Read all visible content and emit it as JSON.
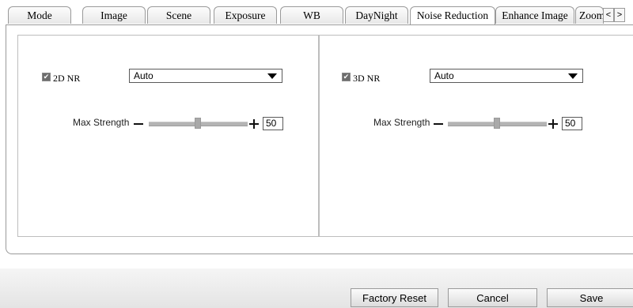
{
  "tabs": [
    {
      "label": "Mode",
      "active": false
    },
    {
      "label": "Image",
      "active": false
    },
    {
      "label": "Scene",
      "active": false
    },
    {
      "label": "Exposure",
      "active": false
    },
    {
      "label": "WB",
      "active": false
    },
    {
      "label": "DayNight",
      "active": false
    },
    {
      "label": "Noise Reduction",
      "active": true
    },
    {
      "label": "Enhance Image",
      "active": false
    },
    {
      "label": "Zoom",
      "active": false
    }
  ],
  "tab_nav": {
    "prev": "<",
    "next": ">"
  },
  "nr2d": {
    "checkbox_label": "2D NR",
    "checked": true,
    "mode": "Auto",
    "max_strength_label": "Max Strength",
    "max_strength_value": "50"
  },
  "nr3d": {
    "checkbox_label": "3D NR",
    "checked": true,
    "mode": "Auto",
    "max_strength_label": "Max Strength",
    "max_strength_value": "50"
  },
  "buttons": {
    "factory_reset": "Factory Reset",
    "cancel": "Cancel",
    "save": "Save"
  },
  "icons": {
    "check": "check-icon",
    "dropdown": "triangle-down-icon",
    "minus": "minus-icon",
    "plus": "plus-icon"
  }
}
